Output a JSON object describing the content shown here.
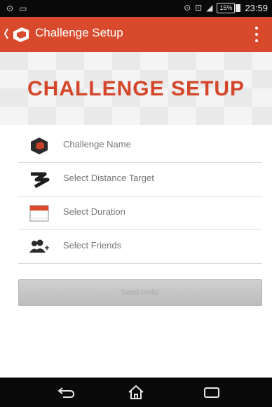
{
  "status_bar": {
    "battery": "15%",
    "time": "23:59"
  },
  "action_bar": {
    "title": "Challenge Setup",
    "menu_icon": "overflow-menu-icon",
    "accent_color": "#d94a2c"
  },
  "banner": {
    "title": "CHALLENGE SETUP"
  },
  "form": {
    "items": [
      {
        "label": "Challenge Name",
        "icon": "challenge-badge-icon"
      },
      {
        "label": "Select Distance Target",
        "icon": "road-icon"
      },
      {
        "label": "Select Duration",
        "icon": "calendar-icon"
      },
      {
        "label": "Select Friends",
        "icon": "add-friends-icon"
      }
    ],
    "send_label": "Send Invite"
  },
  "nav_bar": {
    "back": "back-icon",
    "home": "home-icon",
    "recents": "recents-icon"
  }
}
